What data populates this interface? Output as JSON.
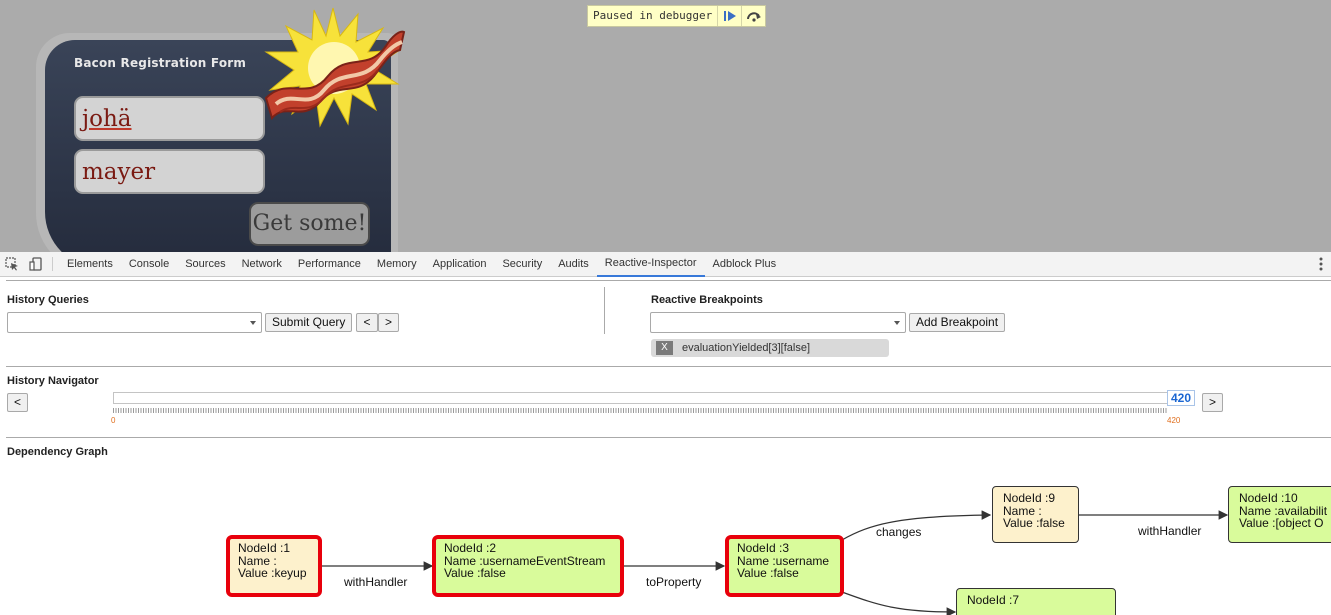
{
  "webpage": {
    "debugger_banner": "Paused in debugger",
    "form": {
      "title": "Bacon Registration Form",
      "first_name_value": "johä",
      "last_name_value": "mayer",
      "submit_label": "Get some!"
    }
  },
  "devtools": {
    "tabs": [
      "Elements",
      "Console",
      "Sources",
      "Network",
      "Performance",
      "Memory",
      "Application",
      "Security",
      "Audits",
      "Reactive-Inspector",
      "Adblock Plus"
    ],
    "active_tab": "Reactive-Inspector",
    "history_queries": {
      "label": "History Queries",
      "submit_label": "Submit Query",
      "prev_label": "<",
      "next_label": ">"
    },
    "breakpoints": {
      "label": "Reactive Breakpoints",
      "add_label": "Add Breakpoint",
      "items": [
        {
          "remove_label": "X",
          "text": "evaluationYielded[3][false]"
        }
      ]
    },
    "navigator": {
      "label": "History Navigator",
      "prev_label": "<",
      "next_label": ">",
      "current": "420",
      "min": "0",
      "max": "420",
      "position_fraction": 1.0
    },
    "graph": {
      "label": "Dependency Graph",
      "nodes": [
        {
          "id_line": "NodeId :1",
          "name_line": "Name :",
          "value_line": "Value :keyup",
          "color": "yellow",
          "highlighted": true
        },
        {
          "id_line": "NodeId :2",
          "name_line": "Name :usernameEventStream",
          "value_line": "Value :false",
          "color": "green",
          "highlighted": true
        },
        {
          "id_line": "NodeId :3",
          "name_line": "Name :username",
          "value_line": "Value :false",
          "color": "green",
          "highlighted": true
        },
        {
          "id_line": "NodeId :9",
          "name_line": "Name :",
          "value_line": "Value :false",
          "color": "yellow",
          "highlighted": false
        },
        {
          "id_line": "NodeId :10",
          "name_line": "Name :availabilit",
          "value_line": "Value :[object O",
          "color": "green",
          "highlighted": false
        },
        {
          "id_line": "NodeId :7",
          "name_line": "",
          "value_line": "",
          "color": "green",
          "highlighted": false
        }
      ],
      "edges": [
        "withHandler",
        "toProperty",
        "changes",
        "withHandler"
      ]
    }
  },
  "colors": {
    "highlight_border": "#e8000b",
    "node_green": "#d9fb9b",
    "node_yellow": "#fdf1cc",
    "accent_blue": "#1a66d2"
  }
}
